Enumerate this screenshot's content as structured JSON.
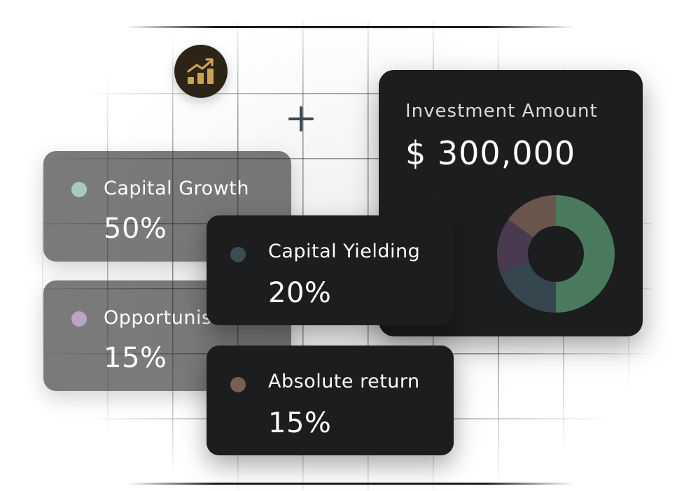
{
  "investment": {
    "title": "Investment Amount",
    "amount": "$ 300,000"
  },
  "allocations": [
    {
      "label": "Capital Growth",
      "value": "50%",
      "color": "#a8cbb8",
      "chart_color": "#4a7a5e",
      "share": 50
    },
    {
      "label": "Opportunistic",
      "value": "15%",
      "color": "#b8a6bd",
      "chart_color": "#4a3a4f",
      "share": 15
    },
    {
      "label": "Capital Yielding",
      "value": "20%",
      "color": "#3e4c54",
      "chart_color": "#36464e",
      "share": 20
    },
    {
      "label": "Absolute return",
      "value": "15%",
      "color": "#7a5e52",
      "chart_color": "#6a554c",
      "share": 15
    }
  ],
  "colors": {
    "badge_bg": "#2d2418",
    "badge_icon": "#c9a253",
    "card_dark": "#1b1d1e"
  },
  "icons": {
    "badge": "growth-chart-icon",
    "plus": "plus-icon"
  }
}
